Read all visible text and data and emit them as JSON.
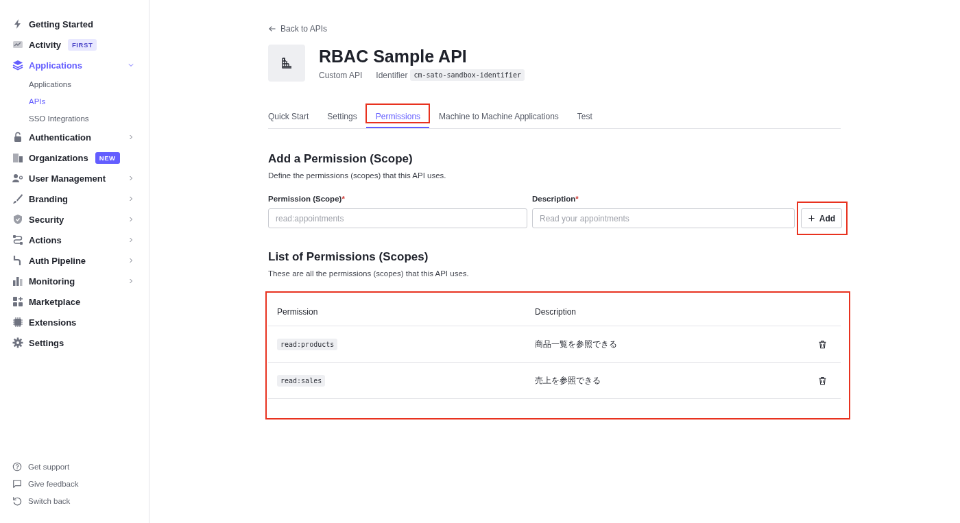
{
  "sidebar": {
    "items": [
      {
        "label": "Getting Started",
        "selected": false
      },
      {
        "label": "Activity",
        "selected": false,
        "badge": {
          "text": "FIRST",
          "kind": "soft"
        }
      },
      {
        "label": "Applications",
        "selected": true,
        "expanded": true,
        "children": [
          {
            "label": "Applications",
            "selected": false
          },
          {
            "label": "APIs",
            "selected": true
          },
          {
            "label": "SSO Integrations",
            "selected": false
          }
        ]
      },
      {
        "label": "Authentication",
        "selected": false,
        "expanded": false
      },
      {
        "label": "Organizations",
        "selected": false,
        "badge": {
          "text": "NEW",
          "kind": "solid"
        }
      },
      {
        "label": "User Management",
        "selected": false,
        "expanded": false
      },
      {
        "label": "Branding",
        "selected": false,
        "expanded": false
      },
      {
        "label": "Security",
        "selected": false,
        "expanded": false
      },
      {
        "label": "Actions",
        "selected": false,
        "expanded": false
      },
      {
        "label": "Auth Pipeline",
        "selected": false,
        "expanded": false
      },
      {
        "label": "Monitoring",
        "selected": false,
        "expanded": false
      },
      {
        "label": "Marketplace",
        "selected": false
      },
      {
        "label": "Extensions",
        "selected": false
      },
      {
        "label": "Settings",
        "selected": false
      }
    ],
    "footer": [
      {
        "label": "Get support"
      },
      {
        "label": "Give feedback"
      },
      {
        "label": "Switch back"
      }
    ]
  },
  "back_link": "Back to APIs",
  "api": {
    "name": "RBAC Sample API",
    "type": "Custom API",
    "identifier_label": "Identifier",
    "identifier": "cm-sato-sandbox-identifier"
  },
  "tabs": [
    {
      "label": "Quick Start",
      "selected": false,
      "highlighted": false
    },
    {
      "label": "Settings",
      "selected": false,
      "highlighted": false
    },
    {
      "label": "Permissions",
      "selected": true,
      "highlighted": true
    },
    {
      "label": "Machine to Machine Applications",
      "selected": false,
      "highlighted": false
    },
    {
      "label": "Test",
      "selected": false,
      "highlighted": false
    }
  ],
  "add_section": {
    "title": "Add a Permission (Scope)",
    "description": "Define the permissions (scopes) that this API uses.",
    "fields": [
      {
        "label": "Permission (Scope)",
        "required_mark": "*",
        "placeholder": "read:appointments"
      },
      {
        "label": "Description",
        "required_mark": "*",
        "placeholder": "Read your appointments"
      }
    ],
    "add_button": {
      "label": "Add",
      "highlighted": true
    }
  },
  "list_section": {
    "title": "List of Permissions (Scopes)",
    "description": "These are all the permissions (scopes) that this API uses.",
    "highlighted": true,
    "columns": [
      "Permission",
      "Description"
    ],
    "rows": [
      {
        "permission": "read:products",
        "description": "商品一覧を参照できる"
      },
      {
        "permission": "read:sales",
        "description": "売上を参照できる"
      }
    ]
  }
}
